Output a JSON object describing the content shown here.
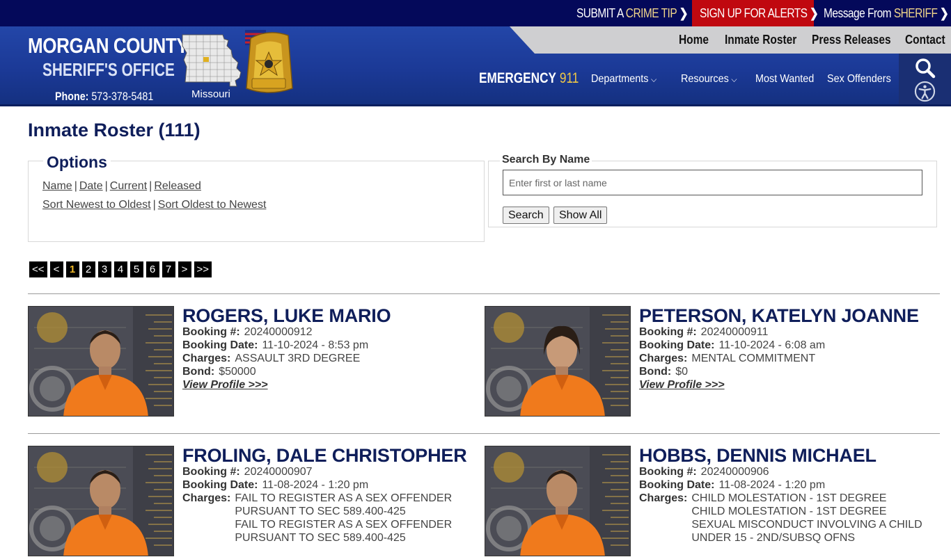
{
  "topbar": {
    "crime_tip_a": "SUBMIT A ",
    "crime_tip_b": "CRIME TIP",
    "alerts": "SIGN UP FOR ALERTS",
    "message_a": "Message From ",
    "message_b": "SHERIFF",
    "chevron": "❯"
  },
  "header": {
    "brand_line1": "MORGAN COUNTY",
    "brand_line2": "SHERIFF'S OFFICE",
    "phone_label": "Phone:",
    "phone_number": "573-378-5481",
    "state_label": "Missouri",
    "emergency_label": "EMERGENCY",
    "emergency_number": "911",
    "nav_top": [
      "Home",
      "Inmate Roster",
      "Press Releases",
      "Contact"
    ],
    "nav_main": [
      "Departments",
      "Resources",
      "Most Wanted",
      "Sex Offenders"
    ],
    "caret": "⌵"
  },
  "page": {
    "title": "Inmate Roster (111)"
  },
  "options": {
    "legend": "Options",
    "sort_links": [
      "Name",
      "Date",
      "Current",
      "Released"
    ],
    "order_links": [
      "Sort Newest to Oldest",
      "Sort Oldest to Newest"
    ],
    "separator": "|"
  },
  "search": {
    "legend": "Search By Name",
    "placeholder": "Enter first or last name",
    "value": "",
    "search_button": "Search",
    "show_all_button": "Show All"
  },
  "pager": {
    "first": "<<",
    "prev": "<",
    "pages": [
      "1",
      "2",
      "3",
      "4",
      "5",
      "6",
      "7"
    ],
    "current": "1",
    "next": ">",
    "last": ">>"
  },
  "labels": {
    "booking_no": "Booking #:",
    "booking_date": "Booking Date:",
    "charges": "Charges:",
    "bond": "Bond:",
    "view_profile": "View Profile >>>"
  },
  "inmates": [
    {
      "name": "ROGERS, LUKE MARIO",
      "booking_no": "20240000912",
      "booking_date": "11-10-2024 - 8:53 pm",
      "charges": [
        "ASSAULT 3RD DEGREE"
      ],
      "bond": "$50000",
      "photo": "mugshot-male"
    },
    {
      "name": "PETERSON, KATELYN JOANNE",
      "booking_no": "20240000911",
      "booking_date": "11-10-2024 - 6:08 am",
      "charges": [
        "MENTAL COMMITMENT"
      ],
      "bond": "$0",
      "photo": "mugshot-female"
    },
    {
      "name": "FROLING, DALE CHRISTOPHER",
      "booking_no": "20240000907",
      "booking_date": "11-08-2024 - 1:20 pm",
      "charges": [
        "FAIL TO REGISTER AS A SEX OFFENDER",
        "PURSUANT TO SEC 589.400-425",
        "FAIL TO REGISTER AS A SEX OFFENDER",
        "PURSUANT TO SEC 589.400-425"
      ],
      "photo": "mugshot-male"
    },
    {
      "name": "HOBBS, DENNIS MICHAEL",
      "booking_no": "20240000906",
      "booking_date": "11-08-2024 - 1:20 pm",
      "charges": [
        "CHILD MOLESTATION - 1ST DEGREE",
        "CHILD MOLESTATION - 1ST DEGREE",
        "SEXUAL MISCONDUCT INVOLVING A CHILD",
        "UNDER 15 - 2ND/SUBSQ OFNS"
      ],
      "photo": "mugshot-male"
    }
  ]
}
